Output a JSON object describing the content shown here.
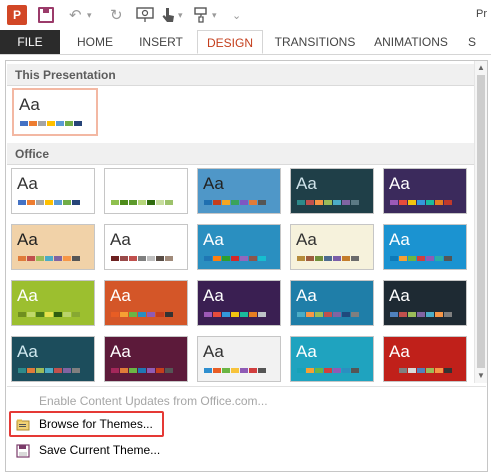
{
  "qat": {
    "app_icon": "P",
    "undo_icon": "↶",
    "redo_icon": "↻",
    "title_fragment": "Pr"
  },
  "tabs": [
    {
      "label": "FILE"
    },
    {
      "label": "HOME"
    },
    {
      "label": "INSERT"
    },
    {
      "label": "DESIGN"
    },
    {
      "label": "TRANSITIONS"
    },
    {
      "label": "ANIMATIONS"
    },
    {
      "label": "S"
    }
  ],
  "gallery": {
    "this_presentation_header": "This Presentation",
    "office_header": "Office",
    "thumbs": [
      {
        "text": "Aa",
        "text_color": "#333333",
        "bg": "#ffffff",
        "swatches": [
          "#4472c4",
          "#ed7d31",
          "#a5a5a5",
          "#ffc000",
          "#5b9bd5",
          "#70ad47",
          "#264478"
        ]
      },
      {
        "text": "Aa",
        "text_color": "#333333",
        "bg": "#ffffff",
        "swatches": [
          "#4472c4",
          "#ed7d31",
          "#a5a5a5",
          "#ffc000",
          "#5b9bd5",
          "#70ad47",
          "#264478"
        ]
      },
      {
        "text": "Aa",
        "text_color": "#ffffff",
        "bg": "#ffffff",
        "swatches": [
          "#8fc04f",
          "#4e8c1a",
          "#5d9a2c",
          "#b6d77a",
          "#2f6b0e",
          "#c7dd9e",
          "#9dc26b"
        ]
      },
      {
        "text": "Aa",
        "text_color": "#222222",
        "bg": "#4f97c8",
        "swatches": [
          "#1f6fb0",
          "#c43e1c",
          "#f5a623",
          "#3aa35a",
          "#7e57c2",
          "#e07b39",
          "#555555"
        ]
      },
      {
        "text": "Aa",
        "text_color": "#cfe3ea",
        "bg": "#1f3f48",
        "swatches": [
          "#2d8a8a",
          "#c0504d",
          "#f79646",
          "#9bbb59",
          "#4bacc6",
          "#8064a2",
          "#5b7a84"
        ]
      },
      {
        "text": "Aa",
        "text_color": "#ffffff",
        "bg": "#3b2a5c",
        "swatches": [
          "#9b59b6",
          "#e74c3c",
          "#f1c40f",
          "#3498db",
          "#1abc9c",
          "#e67e22",
          "#c0392b"
        ]
      },
      {
        "text": "Aa",
        "text_color": "#222222",
        "bg": "#f1d2a8",
        "swatches": [
          "#e07b39",
          "#c0504d",
          "#9bbb59",
          "#4bacc6",
          "#8064a2",
          "#f79646",
          "#555555"
        ]
      },
      {
        "text": "Aa",
        "text_color": "#333333",
        "bg": "#ffffff",
        "swatches": [
          "#6d2121",
          "#9a4a4a",
          "#c0504d",
          "#7f7f7f",
          "#bfbfbf",
          "#594d46",
          "#a08a7a"
        ]
      },
      {
        "text": "Aa",
        "text_color": "#ffffff",
        "bg": "#2a8fc0",
        "swatches": [
          "#1f77b4",
          "#ff7f0e",
          "#2ca02c",
          "#d62728",
          "#9467bd",
          "#8c564b",
          "#17becf"
        ]
      },
      {
        "text": "Aa",
        "text_color": "#333333",
        "bg": "#f6f2dc",
        "swatches": [
          "#b58b3b",
          "#9d5c3e",
          "#6f8f3a",
          "#4d6b8f",
          "#7a5ea8",
          "#c47d2b",
          "#6b6b6b"
        ]
      },
      {
        "text": "Aa",
        "text_color": "#ffffff",
        "bg": "#1b93d1",
        "swatches": [
          "#0e7ab8",
          "#f7a033",
          "#6bb544",
          "#d13e3e",
          "#8f5bb5",
          "#2bb0a6",
          "#555555"
        ]
      },
      {
        "text": "Aa",
        "text_color": "#ffffff",
        "bg": "#9cbf2f",
        "swatches": [
          "#6f8f1f",
          "#c0d86a",
          "#4e7d1a",
          "#e8e14b",
          "#2f5d0f",
          "#b9d36b",
          "#87a832"
        ]
      },
      {
        "text": "Aa",
        "text_color": "#ffffff",
        "bg": "#d45628",
        "swatches": [
          "#e85d24",
          "#f7a033",
          "#6bb544",
          "#2a8fc0",
          "#8f5bb5",
          "#c43e1c",
          "#333333"
        ]
      },
      {
        "text": "Aa",
        "text_color": "#ffffff",
        "bg": "#3a1f52",
        "swatches": [
          "#9b59b6",
          "#e74c3c",
          "#3498db",
          "#f1c40f",
          "#1abc9c",
          "#e67e22",
          "#bdc3c7"
        ]
      },
      {
        "text": "Aa",
        "text_color": "#ffffff",
        "bg": "#1f7ea8",
        "swatches": [
          "#4bacc6",
          "#f79646",
          "#9bbb59",
          "#c0504d",
          "#8064a2",
          "#1f497d",
          "#7f7f7f"
        ]
      },
      {
        "text": "Aa",
        "text_color": "#ffffff",
        "bg": "#1e2a33",
        "swatches": [
          "#4f81bd",
          "#c0504d",
          "#9bbb59",
          "#8064a2",
          "#4bacc6",
          "#f79646",
          "#7f7f7f"
        ]
      },
      {
        "text": "Aa",
        "text_color": "#cfe8ef",
        "bg": "#1c4d5c",
        "swatches": [
          "#2d8a8a",
          "#e07b39",
          "#9bbb59",
          "#4bacc6",
          "#c0504d",
          "#8064a2",
          "#7f7f7f"
        ]
      },
      {
        "text": "Aa",
        "text_color": "#ffffff",
        "bg": "#5c1a3a",
        "swatches": [
          "#a3275a",
          "#e07b39",
          "#6bb544",
          "#1f77b4",
          "#8f5bb5",
          "#c43e1c",
          "#555555"
        ]
      },
      {
        "text": "Aa",
        "text_color": "#333333",
        "bg": "#f2f2f2",
        "swatches": [
          "#2f8fcf",
          "#e85d24",
          "#6bb544",
          "#f7c33b",
          "#8f5bb5",
          "#d13e3e",
          "#555555"
        ]
      },
      {
        "text": "Aa",
        "text_color": "#ffffff",
        "bg": "#1fa3bf",
        "swatches": [
          "#17a2b8",
          "#f7a033",
          "#6bb544",
          "#d13e3e",
          "#8f5bb5",
          "#2a8fc0",
          "#555555"
        ]
      },
      {
        "text": "Aa",
        "text_color": "#ffffff",
        "bg": "#c0201a",
        "swatches": [
          "#c0201a",
          "#7f7f7f",
          "#d9d9d9",
          "#4f81bd",
          "#9bbb59",
          "#f79646",
          "#333333"
        ]
      }
    ]
  },
  "menu": {
    "enable_updates": "Enable Content Updates from Office.com...",
    "browse_themes": "Browse for Themes...",
    "save_theme": "Save Current Theme..."
  }
}
